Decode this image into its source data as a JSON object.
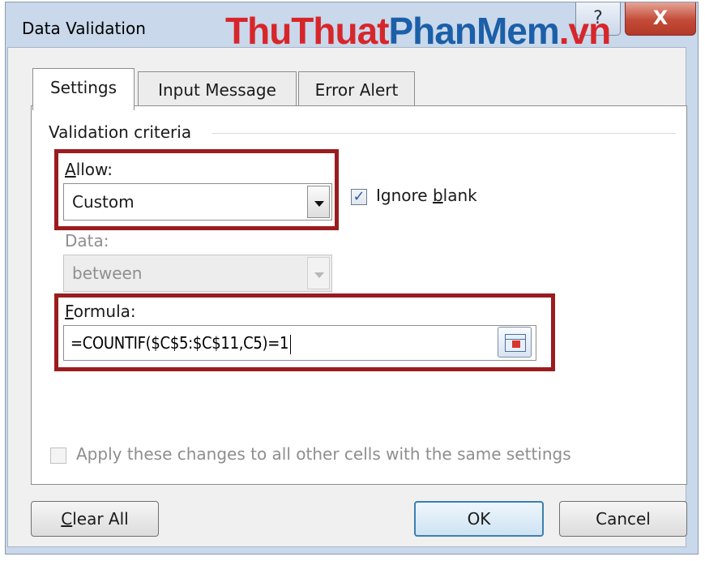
{
  "dialog": {
    "title": "Data Validation",
    "help_label": "?",
    "close_label": "X"
  },
  "watermark": {
    "part1": "ThuThuat",
    "part2": "PhanMem",
    "part3": ".vn"
  },
  "tabs": [
    {
      "label": "Settings",
      "active": true
    },
    {
      "label": "Input Message",
      "active": false
    },
    {
      "label": "Error Alert",
      "active": false
    }
  ],
  "criteria": {
    "group_title": "Validation criteria",
    "allow_label_accel": "A",
    "allow_label_rest": "llow:",
    "allow_value": "Custom",
    "ignore_blank_pre": "Ignore ",
    "ignore_blank_accel": "b",
    "ignore_blank_post": "lank",
    "ignore_blank_checked": true,
    "data_label": "Data:",
    "data_value": "between",
    "formula_label_accel": "F",
    "formula_label_rest": "ormula:",
    "formula_value": "=COUNTIF($C$5:$C$11,C5)=1"
  },
  "apply_all": {
    "label": "Apply these changes to all other cells with the same settings",
    "checked": false
  },
  "buttons": {
    "clear_all_accel": "C",
    "clear_all_rest": "lear All",
    "ok": "OK",
    "cancel": "Cancel"
  },
  "colors": {
    "highlight": "#9a1c1f",
    "watermark_red": "#d7262b",
    "watermark_blue": "#1b5fa8",
    "checkmark": "#2a5ea8"
  }
}
